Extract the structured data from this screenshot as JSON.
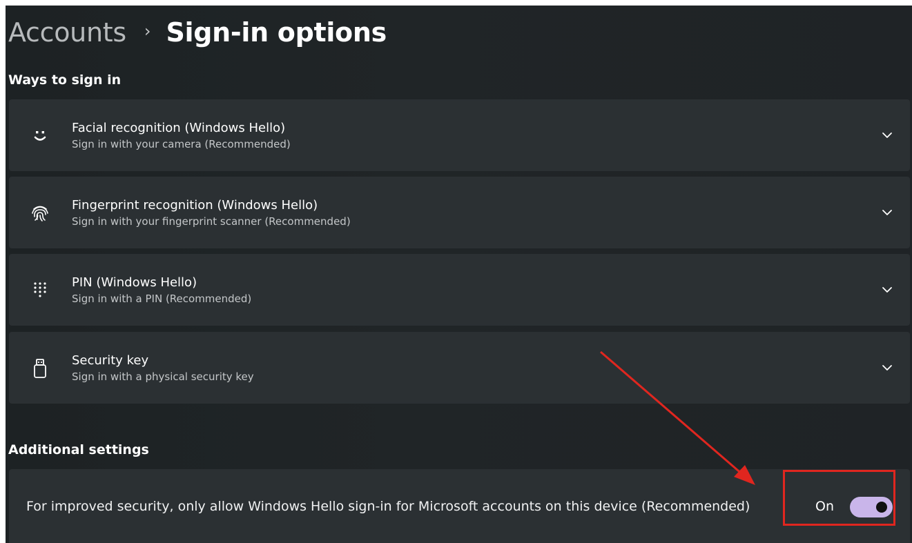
{
  "breadcrumb": {
    "parent": "Accounts",
    "separator": "›",
    "current": "Sign-in options"
  },
  "ways_to_sign_in": {
    "heading": "Ways to sign in",
    "options": [
      {
        "title": "Facial recognition (Windows Hello)",
        "description": "Sign in with your camera (Recommended)",
        "icon": "face-icon"
      },
      {
        "title": "Fingerprint recognition (Windows Hello)",
        "description": "Sign in with your fingerprint scanner (Recommended)",
        "icon": "fingerprint-icon"
      },
      {
        "title": "PIN (Windows Hello)",
        "description": "Sign in with a PIN (Recommended)",
        "icon": "pin-keypad-icon"
      },
      {
        "title": "Security key",
        "description": "Sign in with a physical security key",
        "icon": "usb-key-icon"
      }
    ]
  },
  "additional_settings": {
    "heading": "Additional settings",
    "windows_hello_only": {
      "label": "For improved security, only allow Windows Hello sign-in for Microsoft accounts on this device (Recommended)",
      "state_label": "On",
      "enabled": true
    }
  },
  "colors": {
    "window_background": "#202527",
    "card_background": "#2b3033",
    "toggle_on": "#c9b5ea",
    "annotation": "#e0261f"
  }
}
